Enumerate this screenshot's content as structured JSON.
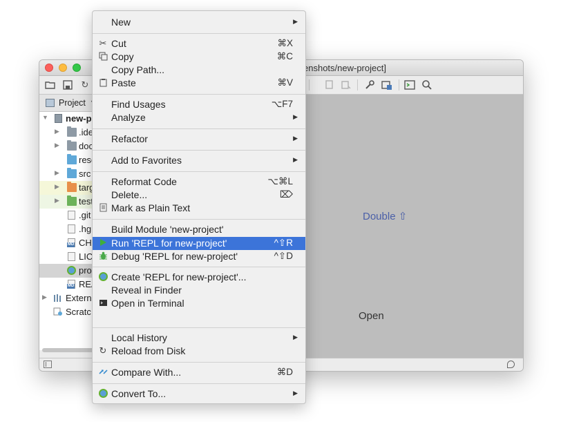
{
  "window": {
    "title": "enshots/new-project]"
  },
  "project_panel": {
    "label": "Project",
    "tree": [
      {
        "label": "new-p",
        "kind": "module"
      },
      {
        "label": ".ide",
        "kind": "folder-grey"
      },
      {
        "label": "doc",
        "kind": "folder-grey"
      },
      {
        "label": "reso",
        "kind": "folder-blue"
      },
      {
        "label": "src",
        "kind": "folder-blue"
      },
      {
        "label": "targ",
        "kind": "folder-orange"
      },
      {
        "label": "test",
        "kind": "folder-green"
      },
      {
        "label": ".git",
        "kind": "file"
      },
      {
        "label": ".hg",
        "kind": "file"
      },
      {
        "label": "CHA",
        "kind": "markdown"
      },
      {
        "label": "LIC",
        "kind": "file"
      },
      {
        "label": "pro",
        "kind": "clojure"
      },
      {
        "label": "REA",
        "kind": "markdown"
      },
      {
        "label": "Extern",
        "kind": "libraries"
      },
      {
        "label": "Scratc",
        "kind": "scratches"
      }
    ]
  },
  "editor": {
    "hint_search": "Double ⇧",
    "hint_open": "Open"
  },
  "context_menu": {
    "new": {
      "label": "New"
    },
    "cut": {
      "label": "Cut",
      "shortcut": "⌘X"
    },
    "copy": {
      "label": "Copy",
      "shortcut": "⌘C"
    },
    "copy_path": {
      "label": "Copy Path..."
    },
    "paste": {
      "label": "Paste",
      "shortcut": "⌘V"
    },
    "find_usages": {
      "label": "Find Usages",
      "shortcut": "⌥F7"
    },
    "analyze": {
      "label": "Analyze"
    },
    "refactor": {
      "label": "Refactor"
    },
    "add_to_favorites": {
      "label": "Add to Favorites"
    },
    "reformat_code": {
      "label": "Reformat Code",
      "shortcut": "⌥⌘L"
    },
    "delete": {
      "label": "Delete...",
      "shortcut": "⌦"
    },
    "mark_plain_text": {
      "label": "Mark as Plain Text"
    },
    "build_module": {
      "label": "Build Module 'new-project'"
    },
    "run_repl": {
      "label": "Run 'REPL for new-project'",
      "shortcut": "^⇧R"
    },
    "debug_repl": {
      "label": "Debug 'REPL for new-project'",
      "shortcut": "^⇧D"
    },
    "create_repl": {
      "label": "Create 'REPL for new-project'..."
    },
    "reveal_finder": {
      "label": "Reveal in Finder"
    },
    "open_terminal": {
      "label": "Open in Terminal"
    },
    "local_history": {
      "label": "Local History"
    },
    "reload_disk": {
      "label": "Reload from Disk"
    },
    "compare_with": {
      "label": "Compare With...",
      "shortcut": "⌘D"
    },
    "convert_to": {
      "label": "Convert To..."
    }
  },
  "colors": {
    "menu_highlight": "#3c74d9",
    "run_icon": "#3fae3a",
    "hint_link": "#4a5fa8"
  }
}
